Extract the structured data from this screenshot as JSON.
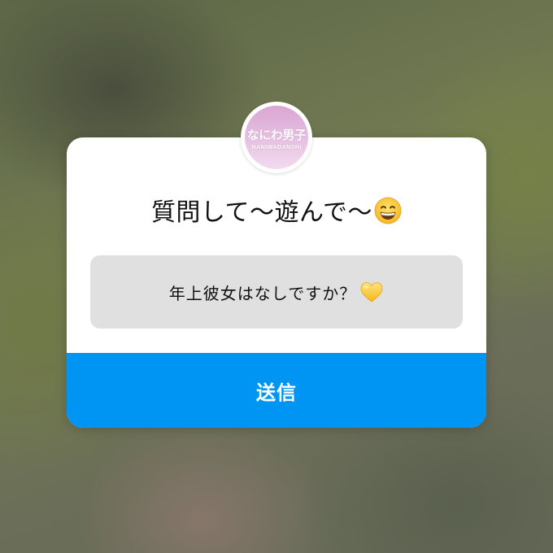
{
  "question_sticker": {
    "avatar": {
      "logo_text_jp": "なにわ男子",
      "logo_text_en": "NANIWADANSHI"
    },
    "prompt": {
      "text": "質問して〜遊んで〜",
      "emoji": "grinning-face-with-smiling-eyes"
    },
    "answer": {
      "text": "年上彼女はなしですか？",
      "emoji": "yellow-heart"
    },
    "send_button": {
      "label": "送信",
      "color": "#0095F3"
    }
  },
  "colors": {
    "card_background": "#FFFFFF",
    "answer_background": "#E0E0E0",
    "avatar_pink": "#E7C1E2"
  }
}
